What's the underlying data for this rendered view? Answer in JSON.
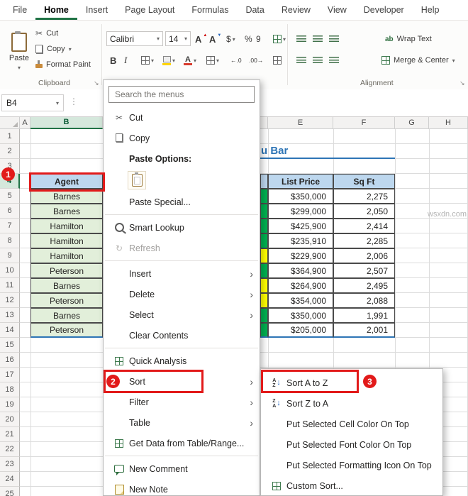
{
  "tabs": [
    {
      "label": "File",
      "active": false
    },
    {
      "label": "Home",
      "active": true
    },
    {
      "label": "Insert",
      "active": false
    },
    {
      "label": "Page Layout",
      "active": false
    },
    {
      "label": "Formulas",
      "active": false
    },
    {
      "label": "Data",
      "active": false
    },
    {
      "label": "Review",
      "active": false
    },
    {
      "label": "View",
      "active": false
    },
    {
      "label": "Developer",
      "active": false
    },
    {
      "label": "Help",
      "active": false
    }
  ],
  "ribbon": {
    "paste": "Paste",
    "cut": "Cut",
    "copy": "Copy",
    "format_painter": "Format Paint",
    "clipboard_group": "Clipboard",
    "font_name": "Calibri",
    "font_size": "14",
    "bold": "B",
    "italic": "I",
    "currency": "$",
    "percent": "%",
    "comma": "9",
    "wrap_text": "Wrap Text",
    "merge_center": "Merge & Center",
    "alignment_group": "Alignment"
  },
  "formula_bar": {
    "name_box": "B4"
  },
  "sheet": {
    "title_fragment": "u Bar",
    "left_columns": [
      {
        "letter": "A",
        "selected": false
      },
      {
        "letter": "B",
        "selected": true
      }
    ],
    "right_columns": [
      {
        "letter": "E",
        "selected": false
      },
      {
        "letter": "F",
        "selected": false
      },
      {
        "letter": "G",
        "selected": false
      },
      {
        "letter": "H",
        "selected": false
      }
    ],
    "row_count": 24,
    "selected_row": 4,
    "table": {
      "headers": {
        "agent": "Agent",
        "price": "List Price",
        "sqft": "Sq Ft"
      },
      "rows": [
        {
          "agent": "Barnes",
          "price": "$350,000",
          "sqft": "2,275",
          "d": "green"
        },
        {
          "agent": "Barnes",
          "price": "$299,000",
          "sqft": "2,050",
          "d": "green"
        },
        {
          "agent": "Hamilton",
          "price": "$425,900",
          "sqft": "2,414",
          "d": "green"
        },
        {
          "agent": "Hamilton",
          "price": "$235,910",
          "sqft": "2,285",
          "d": "green"
        },
        {
          "agent": "Hamilton",
          "price": "$229,900",
          "sqft": "2,006",
          "d": "yellow"
        },
        {
          "agent": "Peterson",
          "price": "$364,900",
          "sqft": "2,507",
          "d": "green"
        },
        {
          "agent": "Barnes",
          "price": "$264,900",
          "sqft": "2,495",
          "d": "yellow"
        },
        {
          "agent": "Peterson",
          "price": "$354,000",
          "sqft": "2,088",
          "d": "yellow"
        },
        {
          "agent": "Barnes",
          "price": "$350,000",
          "sqft": "1,991",
          "d": "green"
        },
        {
          "agent": "Peterson",
          "price": "$205,000",
          "sqft": "2,001",
          "d": "green"
        }
      ]
    }
  },
  "context_menu": {
    "search_placeholder": "Search the menus",
    "items": [
      {
        "label": "Cut",
        "icon": "scissors-icon"
      },
      {
        "label": "Copy",
        "icon": "copy-icon"
      },
      {
        "label": "Paste Options:",
        "heading": true
      },
      {
        "kind": "paste-thumb"
      },
      {
        "label": "Paste Special..."
      },
      {
        "kind": "separator"
      },
      {
        "label": "Smart Lookup",
        "icon": "magnifier-icon"
      },
      {
        "label": "Refresh",
        "icon": "refresh-icon",
        "disabled": true
      },
      {
        "kind": "separator"
      },
      {
        "label": "Insert",
        "arrow": true
      },
      {
        "label": "Delete",
        "arrow": true
      },
      {
        "label": "Select",
        "arrow": true
      },
      {
        "label": "Clear Contents"
      },
      {
        "kind": "separator"
      },
      {
        "label": "Quick Analysis",
        "icon": "quick-analysis-icon"
      },
      {
        "label": "Sort",
        "arrow": true,
        "highlight": true
      },
      {
        "label": "Filter",
        "arrow": true
      },
      {
        "label": "Table",
        "arrow": true
      },
      {
        "label": "Get Data from Table/Range...",
        "icon": "table-range-icon"
      },
      {
        "kind": "separator"
      },
      {
        "label": "New Comment",
        "icon": "comment-icon"
      },
      {
        "label": "New Note",
        "icon": "note-icon"
      }
    ]
  },
  "sort_submenu": {
    "items": [
      {
        "label": "Sort A to Z",
        "icon": "sort-az-icon",
        "highlight": true
      },
      {
        "label": "Sort Z to A",
        "icon": "sort-za-icon"
      },
      {
        "label": "Put Selected Cell Color On Top"
      },
      {
        "label": "Put Selected Font Color On Top"
      },
      {
        "label": "Put Selected Formatting Icon On Top"
      },
      {
        "label": "Custom Sort...",
        "icon": "custom-sort-icon"
      }
    ]
  },
  "annotations": {
    "step1": "1",
    "step2": "2",
    "step3": "3"
  },
  "watermark": "wsxdn.com",
  "colors": {
    "accent_green": "#217346",
    "header_fill": "#BDD7EE",
    "data_fill": "#E2EFDA",
    "cond_green": "#00B050",
    "cond_yellow": "#FFFF00",
    "annotation_red": "#E21A1A",
    "title_blue": "#2E75B6"
  }
}
